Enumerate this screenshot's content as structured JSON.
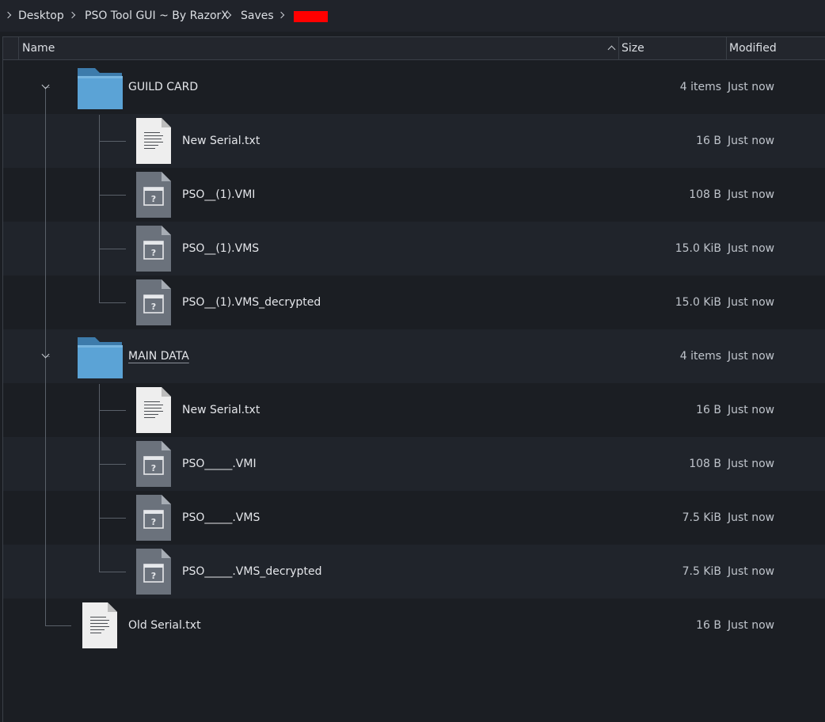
{
  "breadcrumb": {
    "items": [
      "Desktop",
      "PSO Tool GUI ~ By RazorX",
      "Saves"
    ],
    "redacted_color": "#ff0000"
  },
  "columns": {
    "name": "Name",
    "size": "Size",
    "modified": "Modified"
  },
  "rows": [
    {
      "name": "GUILD CARD",
      "size": "4 items",
      "modified": "Just now",
      "icon": "folder-icon"
    },
    {
      "name": "New Serial.txt",
      "size": "16 B",
      "modified": "Just now",
      "icon": "text-file-icon"
    },
    {
      "name": "PSO__(1).VMI",
      "size": "108 B",
      "modified": "Just now",
      "icon": "unknown-file-icon"
    },
    {
      "name": "PSO__(1).VMS",
      "size": "15.0 KiB",
      "modified": "Just now",
      "icon": "unknown-file-icon"
    },
    {
      "name": "PSO__(1).VMS_decrypted",
      "size": "15.0 KiB",
      "modified": "Just now",
      "icon": "unknown-file-icon"
    },
    {
      "name": "MAIN DATA",
      "size": "4 items",
      "modified": "Just now",
      "icon": "folder-icon"
    },
    {
      "name": "New Serial.txt",
      "size": "16 B",
      "modified": "Just now",
      "icon": "text-file-icon"
    },
    {
      "name": "PSO_____.VMI",
      "size": "108 B",
      "modified": "Just now",
      "icon": "unknown-file-icon"
    },
    {
      "name": "PSO_____.VMS",
      "size": "7.5 KiB",
      "modified": "Just now",
      "icon": "unknown-file-icon"
    },
    {
      "name": "PSO_____.VMS_decrypted",
      "size": "7.5 KiB",
      "modified": "Just now",
      "icon": "unknown-file-icon"
    },
    {
      "name": "Old Serial.txt",
      "size": "16 B",
      "modified": "Just now",
      "icon": "text-file-icon"
    }
  ],
  "colors": {
    "background": "#1b1e23",
    "folder": "#5ba3d6",
    "folder_tab": "#3d7bab"
  }
}
